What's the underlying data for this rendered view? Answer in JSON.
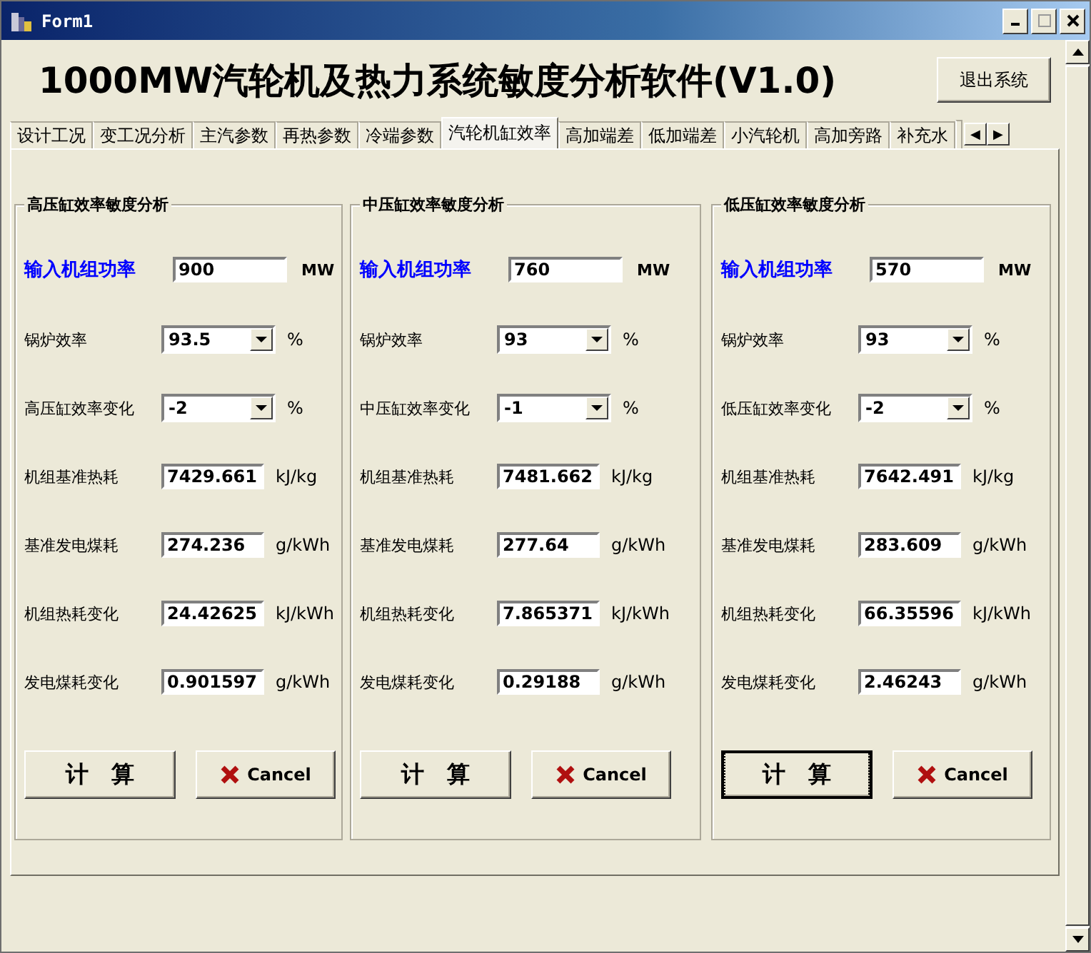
{
  "window": {
    "title": "Form1"
  },
  "heading": "1000MW汽轮机及热力系统敏度分析软件(V1.0)",
  "exit_button": "退出系统",
  "tabs": [
    {
      "label": "设计工况",
      "selected": false
    },
    {
      "label": "变工况分析",
      "selected": false
    },
    {
      "label": "主汽参数",
      "selected": false
    },
    {
      "label": "再热参数",
      "selected": false
    },
    {
      "label": "冷端参数",
      "selected": false
    },
    {
      "label": "汽轮机缸效率",
      "selected": true
    },
    {
      "label": "高加端差",
      "selected": false
    },
    {
      "label": "低加端差",
      "selected": false
    },
    {
      "label": "小汽轮机",
      "selected": false
    },
    {
      "label": "高加旁路",
      "selected": false
    },
    {
      "label": "补充水",
      "selected": false
    }
  ],
  "tab_scroll": [
    "◀",
    "▶"
  ],
  "groups": [
    {
      "title": "高压缸效率敏度分析",
      "power_label": "输入机组功率",
      "power": "900",
      "power_unit": "MW",
      "rows": [
        {
          "kind": "combo",
          "label": "锅炉效率",
          "value": "93.5",
          "unit": "%"
        },
        {
          "kind": "combo",
          "label": "高压缸效率变化",
          "value": "-2",
          "unit": "%"
        },
        {
          "kind": "field",
          "label": "机组基准热耗",
          "value": "7429.661",
          "unit": "kJ/kg"
        },
        {
          "kind": "field",
          "label": "基准发电煤耗",
          "value": "274.236",
          "unit": "g/kWh"
        },
        {
          "kind": "field",
          "label": "机组热耗变化",
          "value": "24.42625",
          "unit": "kJ/kWh"
        },
        {
          "kind": "field",
          "label": "发电煤耗变化",
          "value": "0.901597",
          "unit": "g/kWh"
        }
      ],
      "calc_button": "计　算",
      "calc_focused": false,
      "cancel_button": "Cancel"
    },
    {
      "title": "中压缸效率敏度分析",
      "power_label": "输入机组功率",
      "power": "760",
      "power_unit": "MW",
      "rows": [
        {
          "kind": "combo",
          "label": "锅炉效率",
          "value": "93",
          "unit": "%"
        },
        {
          "kind": "combo",
          "label": "中压缸效率变化",
          "value": "-1",
          "unit": "%"
        },
        {
          "kind": "field",
          "label": "机组基准热耗",
          "value": "7481.662",
          "unit": "kJ/kg"
        },
        {
          "kind": "field",
          "label": "基准发电煤耗",
          "value": "277.64",
          "unit": "g/kWh"
        },
        {
          "kind": "field",
          "label": "机组热耗变化",
          "value": "7.865371",
          "unit": "kJ/kWh"
        },
        {
          "kind": "field",
          "label": "发电煤耗变化",
          "value": "0.29188",
          "unit": "g/kWh"
        }
      ],
      "calc_button": "计　算",
      "calc_focused": false,
      "cancel_button": "Cancel"
    },
    {
      "title": "低压缸效率敏度分析",
      "power_label": "输入机组功率",
      "power": "570",
      "power_unit": "MW",
      "rows": [
        {
          "kind": "combo",
          "label": "锅炉效率",
          "value": "93",
          "unit": "%"
        },
        {
          "kind": "combo",
          "label": "低压缸效率变化",
          "value": "-2",
          "unit": "%"
        },
        {
          "kind": "field",
          "label": "机组基准热耗",
          "value": "7642.491",
          "unit": "kJ/kg"
        },
        {
          "kind": "field",
          "label": "基准发电煤耗",
          "value": "283.609",
          "unit": "g/kWh"
        },
        {
          "kind": "field",
          "label": "机组热耗变化",
          "value": "66.35596",
          "unit": "kJ/kWh"
        },
        {
          "kind": "field",
          "label": "发电煤耗变化",
          "value": "2.46243",
          "unit": "g/kWh"
        }
      ],
      "calc_button": "计　算",
      "calc_focused": true,
      "cancel_button": "Cancel"
    }
  ]
}
